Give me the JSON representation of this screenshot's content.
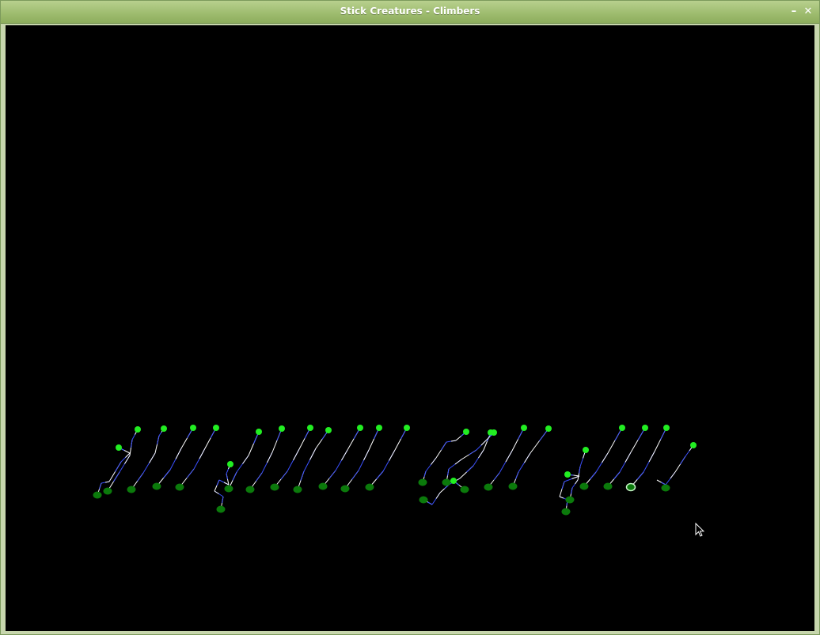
{
  "window": {
    "title": "Stick Creatures - Climbers",
    "minimize_label": "–",
    "close_label": "✕"
  },
  "scene": {
    "background_color": "#000000",
    "colors": {
      "limb_white": "#ffffff",
      "limb_blue": "#3a50ff",
      "hand_bright": "#22ee22",
      "foot_dark": "#0b7a0b",
      "selected_ring": "#c8f5c8"
    }
  }
}
